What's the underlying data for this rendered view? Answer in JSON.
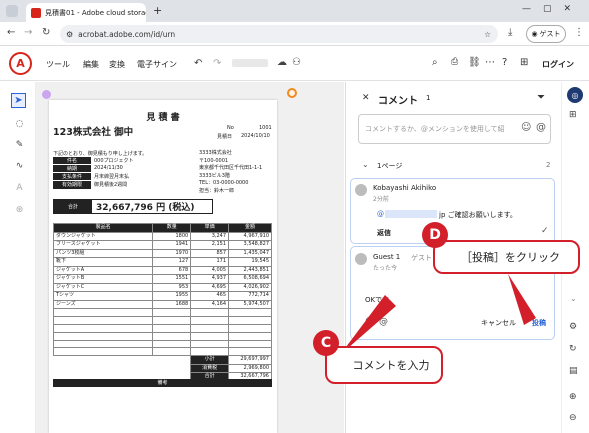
{
  "browser": {
    "tab_title": "見積書01 - Adobe cloud storag",
    "new_tab": "+",
    "url": "acrobat.adobe.com/id/urn",
    "profile_label": "ゲスト"
  },
  "app": {
    "logo": "A",
    "menu": [
      "ツール",
      "編集",
      "変換",
      "電子サイン"
    ],
    "login": "ログイン"
  },
  "document": {
    "title": "見 積 書",
    "client": "123株式会社 御中",
    "no_label": "No",
    "no_value": "1001",
    "date_label": "見積日",
    "date_value": "2024/10/10",
    "intro": "下記のとおり、御見積もり申し上げます。",
    "info": [
      {
        "k": "件名",
        "v": "000プロジェクト"
      },
      {
        "k": "納期",
        "v": "2024/11/30"
      },
      {
        "k": "支払条件",
        "v": "月末締翌月末払"
      },
      {
        "k": "有効期限",
        "v": "御見積後2週間"
      }
    ],
    "company": [
      "3333株式会社",
      "〒100-0001",
      "東京都千代田区千代田1-1-1",
      "3333ビル3階",
      "TEL：03-0000-0000",
      "担当：鈴木一郎"
    ],
    "total_label": "合計",
    "total_value": "32,667,796 円 (税込)",
    "table_headers": [
      "製品名",
      "数量",
      "単価",
      "金額"
    ],
    "rows": [
      [
        "ダウンジャケット",
        "1800",
        "3,247",
        "4,967,910"
      ],
      [
        "フリースジャケット",
        "1941",
        "2,151",
        "3,548,827"
      ],
      [
        "パンツ3枚組",
        "1970",
        "857",
        "1,435,047"
      ],
      [
        "靴下",
        "127",
        "171",
        "19,545"
      ],
      [
        "ジャケットA",
        "678",
        "4,005",
        "2,443,851"
      ],
      [
        "ジャケットB",
        "1551",
        "4,937",
        "6,508,694"
      ],
      [
        "ジャケットC",
        "953",
        "4,695",
        "4,026,902"
      ],
      [
        "Tシャツ",
        "1955",
        "465",
        "772,714"
      ],
      [
        "ジーンズ",
        "1688",
        "4,164",
        "5,974,507"
      ]
    ],
    "summary": [
      {
        "k": "小計",
        "v": "29,697,997"
      },
      {
        "k": "消費税",
        "v": "2,969,800"
      },
      {
        "k": "合計",
        "v": "32,667,796"
      }
    ],
    "remarks": "備考"
  },
  "panel": {
    "title": "コメント",
    "count": "1",
    "input_placeholder": "コメントするか、@メンションを使用して紹",
    "page_label": "1ページ",
    "page_count": "2",
    "comment1": {
      "author": "Kobayashi Akihiko",
      "time": "2分前",
      "text_prefix": "@",
      "text_suffix": "jp ご確認お願いします。",
      "reply": "返信"
    },
    "comment2": {
      "author": "Guest 1",
      "author_suffix": "ゲスト",
      "time": "たった今",
      "draft": "OKです",
      "cancel": "キャンセル",
      "post": "投稿"
    }
  },
  "annotations": {
    "c_badge": "C",
    "c_text": "コメントを入力",
    "d_badge": "D",
    "d_text": "［投稿］をクリック",
    "color": "#d21f2a"
  }
}
